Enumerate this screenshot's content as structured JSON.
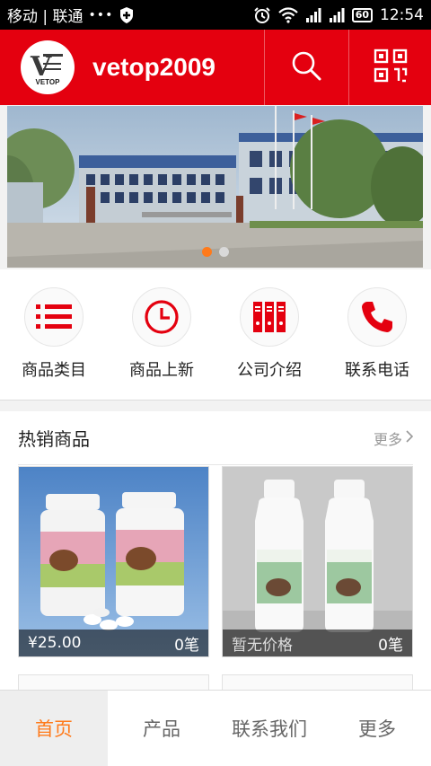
{
  "status_bar": {
    "carrier": "移动 | 联通",
    "dots": "•••",
    "battery": "60",
    "time": "12:54"
  },
  "header": {
    "title": "vetop2009",
    "logo_text": "VETOP",
    "search_icon": "search-icon",
    "qr_icon": "qrcode-icon"
  },
  "banner": {
    "dots_count": 2,
    "active_index": 0
  },
  "quick_nav": [
    {
      "label": "商品类目",
      "icon": "list-icon"
    },
    {
      "label": "商品上新",
      "icon": "clock-icon"
    },
    {
      "label": "公司介绍",
      "icon": "binders-icon"
    },
    {
      "label": "联系电话",
      "icon": "phone-icon"
    }
  ],
  "hot_section": {
    "title": "热销商品",
    "more": "更多",
    "products": [
      {
        "price": "¥25.00",
        "sold": "0笔"
      },
      {
        "price": "暂无价格",
        "sold": "0笔"
      }
    ]
  },
  "tab_bar": [
    {
      "label": "首页",
      "active": true
    },
    {
      "label": "产品",
      "active": false
    },
    {
      "label": "联系我们",
      "active": false
    },
    {
      "label": "更多",
      "active": false
    }
  ],
  "colors": {
    "brand_red": "#e4000f",
    "accent_orange": "#ff7a1a"
  }
}
